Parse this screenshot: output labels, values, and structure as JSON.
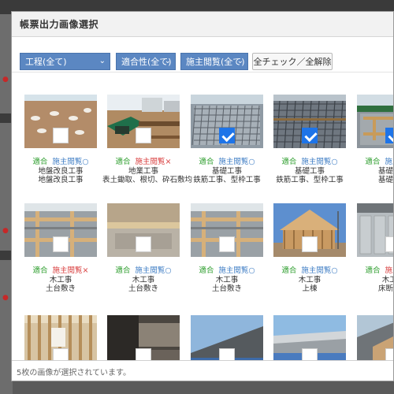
{
  "modal": {
    "title": "帳票出力画像選択"
  },
  "toolbar": {
    "filters": [
      {
        "label": "工程(全て)"
      },
      {
        "label": "適合性(全て)"
      },
      {
        "label": "施主閲覧(全て)"
      }
    ],
    "check_all_label": "全チェック／全解除"
  },
  "gallery": {
    "tiles": [
      {
        "fit": "適合",
        "view": "施主閲覧○",
        "view_status": "ok",
        "process": "地盤改良工事",
        "work": "地盤改良工事",
        "checked": false,
        "scene": "soil"
      },
      {
        "fit": "適合",
        "view": "施主閲覧×",
        "view_status": "ng",
        "process": "地業工事",
        "work": "表土鋤取、根切、砕石敷均",
        "checked": false,
        "scene": "excavator"
      },
      {
        "fit": "適合",
        "view": "施主閲覧○",
        "view_status": "ok",
        "process": "基礎工事",
        "work": "鉄筋工事、型枠工事",
        "checked": true,
        "scene": "rebar"
      },
      {
        "fit": "適合",
        "view": "施主閲覧○",
        "view_status": "ok",
        "process": "基礎工事",
        "work": "鉄筋工事、型枠工事",
        "checked": true,
        "scene": "rebar2"
      },
      {
        "fit": "適合",
        "view": "施主閲覧○",
        "view_status": "ok",
        "process": "基礎工事",
        "work": "基礎立上",
        "checked": true,
        "scene": "foundation"
      },
      {
        "fit": "適合",
        "view": "施主閲覧×",
        "view_status": "ng",
        "process": "木工事",
        "work": "土台敷き",
        "checked": false,
        "scene": "sill"
      },
      {
        "fit": "適合",
        "view": "施主閲覧○",
        "view_status": "ok",
        "process": "木工事",
        "work": "土台敷き",
        "checked": false,
        "scene": "sill2"
      },
      {
        "fit": "適合",
        "view": "施主閲覧○",
        "view_status": "ok",
        "process": "木工事",
        "work": "土台敷き",
        "checked": false,
        "scene": "sill"
      },
      {
        "fit": "適合",
        "view": "施主閲覧○",
        "view_status": "ok",
        "process": "木工事",
        "work": "上棟",
        "checked": false,
        "scene": "framing"
      },
      {
        "fit": "適合",
        "view": "施主閲覧×",
        "view_status": "ng",
        "process": "木工事",
        "work": "床断熱材",
        "checked": false,
        "scene": "floor"
      },
      {
        "checked": false,
        "scene": "interior"
      },
      {
        "checked": false,
        "scene": "dark"
      },
      {
        "checked": false,
        "scene": "roof"
      },
      {
        "checked": false,
        "scene": "roof2"
      },
      {
        "checked": false,
        "scene": "roofgrey"
      }
    ]
  },
  "footer": {
    "status": "5枚の画像が選択されています。"
  },
  "background": {
    "marks": [
      "●",
      "●",
      "●",
      "●"
    ]
  }
}
